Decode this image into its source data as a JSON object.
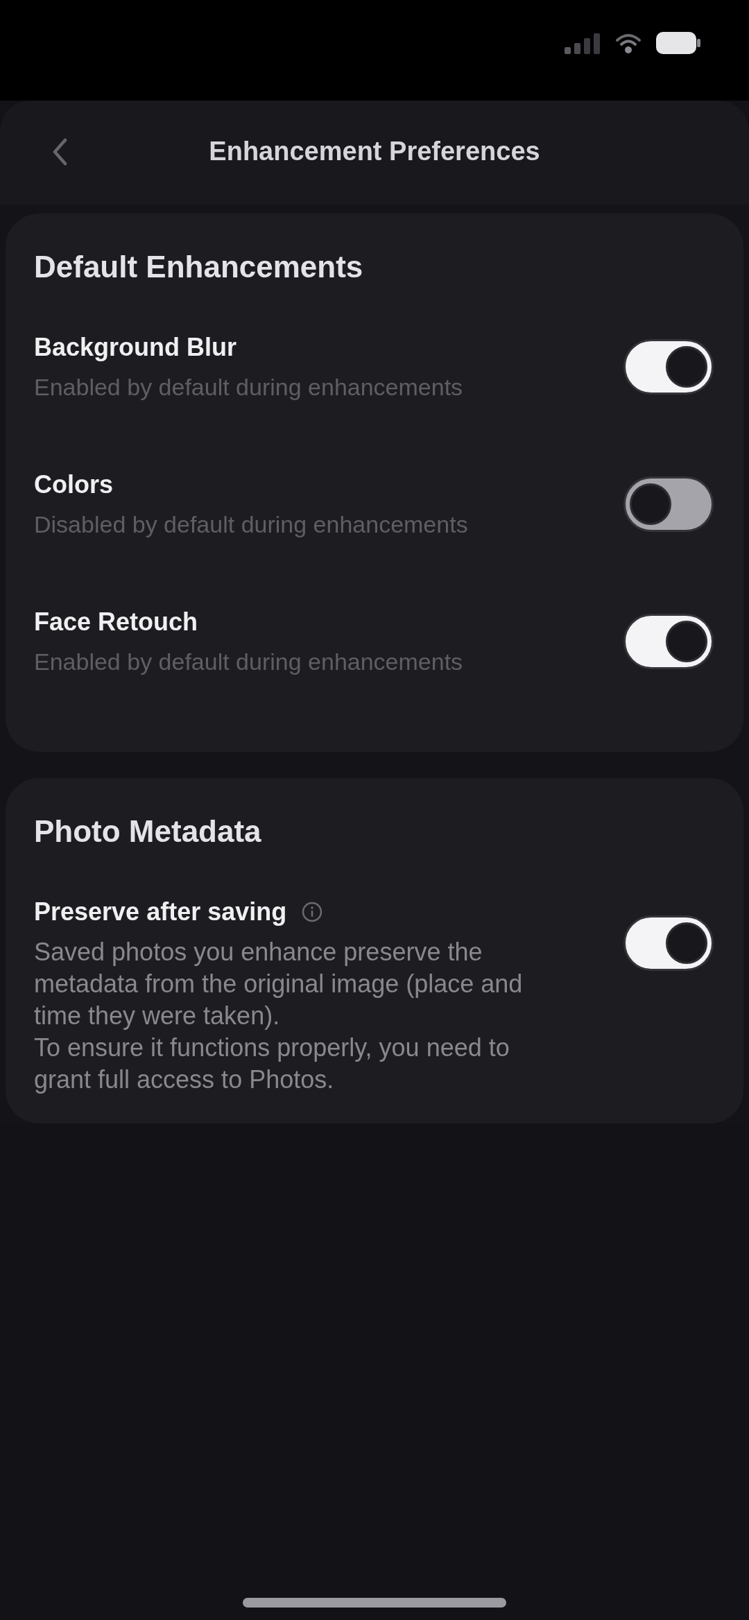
{
  "header": {
    "title": "Enhancement Preferences"
  },
  "sections": [
    {
      "title": "Default Enhancements",
      "settings": [
        {
          "label": "Background Blur",
          "description": [
            "Enabled by default during enhancements"
          ],
          "on": true
        },
        {
          "label": "Colors",
          "description": [
            "Disabled by default during enhancements"
          ],
          "on": false
        },
        {
          "label": "Face Retouch",
          "description": [
            "Enabled by default during enhancements"
          ],
          "on": true
        }
      ]
    },
    {
      "title": "Photo Metadata",
      "settings": [
        {
          "label": "Preserve after saving",
          "info": true,
          "description": [
            "Saved photos you enhance preserve the metadata from the original image (place and time they were taken).",
            "To ensure it functions properly, you need to grant full access to Photos."
          ],
          "on": true
        }
      ]
    }
  ]
}
